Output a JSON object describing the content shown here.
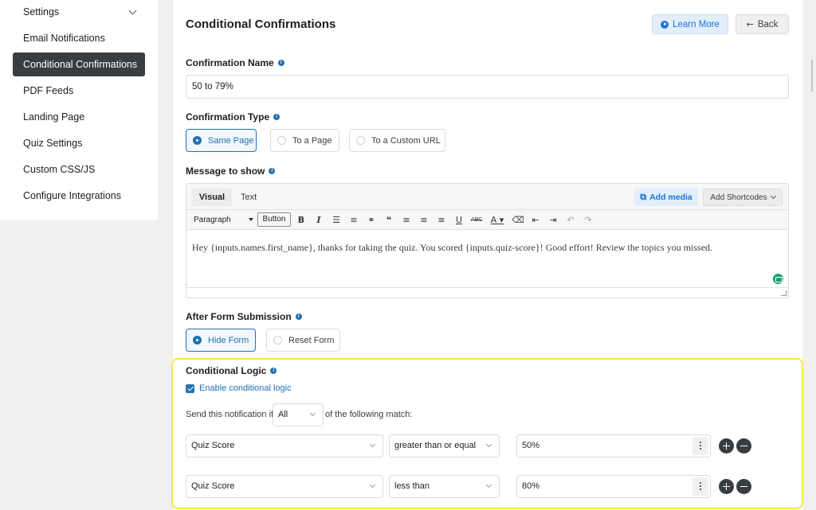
{
  "sidebar": {
    "items": [
      {
        "label": "Settings"
      },
      {
        "label": "Email Notifications"
      },
      {
        "label": "Conditional Confirmations"
      },
      {
        "label": "PDF Feeds"
      },
      {
        "label": "Landing Page"
      },
      {
        "label": "Quiz Settings"
      },
      {
        "label": "Custom CSS/JS"
      },
      {
        "label": "Configure Integrations"
      }
    ],
    "active_index": 2
  },
  "header": {
    "title": "Conditional Confirmations",
    "learn_more": "Learn More",
    "back": "Back"
  },
  "form": {
    "confirmation_name_label": "Confirmation Name",
    "confirmation_name_value": "50 to 79%",
    "confirmation_type_label": "Confirmation Type",
    "confirmation_type_options": [
      "Same Page",
      "To a Page",
      "To a Custom URL"
    ],
    "confirmation_type_selected": "Same Page",
    "message_label": "Message to show",
    "after_submission_label": "After Form Submission",
    "after_submission_options": [
      "Hide Form",
      "Reset Form"
    ],
    "after_submission_selected": "Hide Form"
  },
  "editor": {
    "tab_visual": "Visual",
    "tab_text": "Text",
    "add_media": "Add media",
    "add_shortcodes": "Add Shortcodes",
    "paragraph_select": "Paragraph",
    "button_label": "Button",
    "toolbar_icons": [
      "bold-icon",
      "italic-icon",
      "bullet-list-icon",
      "numbered-list-icon",
      "link-icon",
      "blockquote-icon",
      "align-left-icon",
      "align-center-icon",
      "align-right-icon",
      "underline-icon",
      "strikethrough-icon",
      "text-color-icon",
      "clear-format-icon",
      "outdent-icon",
      "indent-icon",
      "undo-icon",
      "redo-icon"
    ],
    "content": "Hey {inputs.names.first_name}, thanks for taking the quiz. You scored {inputs.quiz-score}! Good effort! Review the topics you missed."
  },
  "conditional_logic": {
    "label": "Conditional Logic",
    "enable_label": "Enable conditional logic",
    "enabled": true,
    "send_prefix": "Send this notification if",
    "match_value": "All",
    "send_suffix": "of the following match:",
    "rules": [
      {
        "field": "Quiz Score",
        "operator": "greater than or equal",
        "value": "50%"
      },
      {
        "field": "Quiz Score",
        "operator": "less than",
        "value": "80%"
      }
    ]
  },
  "colors": {
    "accent": "#2271b1",
    "highlight_border": "#f3e849",
    "sidebar_active": "#3a3d40"
  }
}
